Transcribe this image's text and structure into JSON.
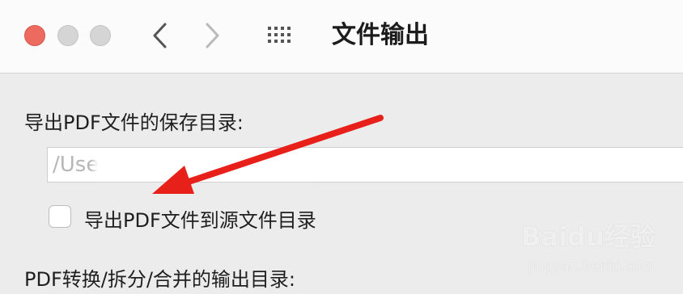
{
  "window": {
    "title": "文件输出",
    "traffic_light_colors": {
      "close": "#ed6a5e",
      "minimize": "#d5d5d5",
      "maximize": "#d5d5d5"
    },
    "toolbar_icons": [
      "back-icon",
      "forward-icon",
      "grid-icon"
    ]
  },
  "settings": {
    "save_dir_label": "导出PDF文件的保存目录:",
    "save_dir_value": "/Use",
    "same_as_source_checkbox": {
      "label": "导出PDF文件到源文件目录",
      "checked": false
    },
    "convert_dir_label": "PDF转换/拆分/合并的输出目录:"
  },
  "annotation": {
    "arrow_color": "#e8201a"
  },
  "watermark": {
    "logo": "Baidu经验",
    "url": "jingyan.baidu.com"
  }
}
